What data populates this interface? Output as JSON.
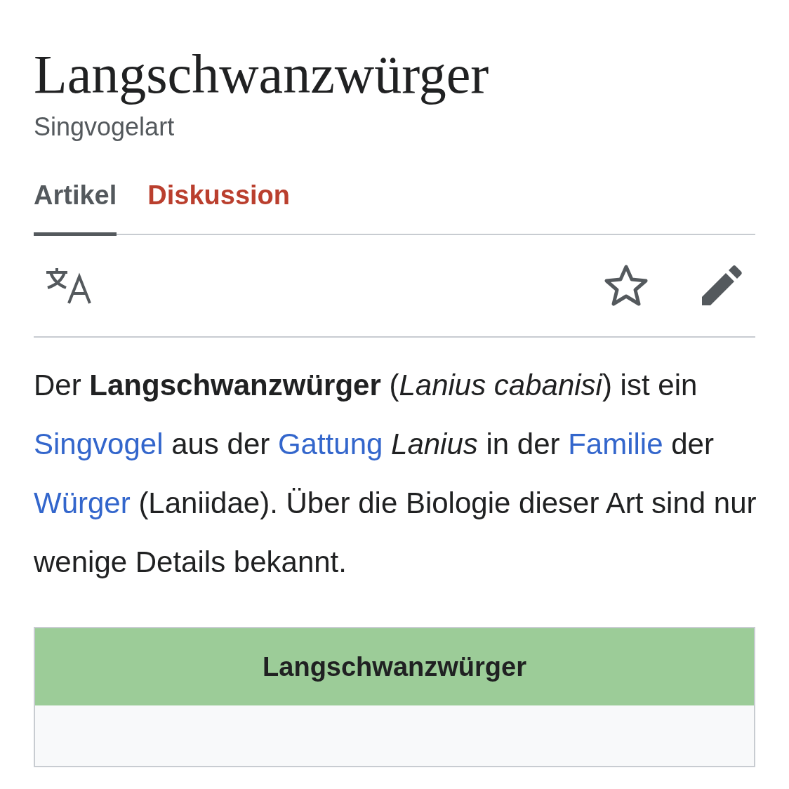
{
  "page": {
    "title": "Langschwanzwürger",
    "description": "Singvogelart"
  },
  "tabs": [
    {
      "label": "Artikel",
      "selected": true
    },
    {
      "label": "Diskussion",
      "selected": false
    }
  ],
  "intro": [
    {
      "kind": "text",
      "text": "Der **Langschwanzwürger** (*Lanius cabanisi*) ist ein"
    },
    {
      "kind": "link",
      "text": "Singvogel"
    },
    {
      "kind": "text",
      "text": "aus der"
    },
    {
      "kind": "link",
      "text": "Gattung"
    },
    {
      "kind": "text",
      "text": "*Lanius* in der"
    },
    {
      "kind": "link",
      "text": "Familie"
    },
    {
      "kind": "text",
      "text": "der"
    },
    {
      "kind": "link",
      "text": "Würger"
    },
    {
      "kind": "text",
      "text": "(Laniidae). Über die Biologie dieser Art sind nur wenige Details bekannt."
    }
  ],
  "infobox": {
    "title": "Langschwanzwürger"
  }
}
